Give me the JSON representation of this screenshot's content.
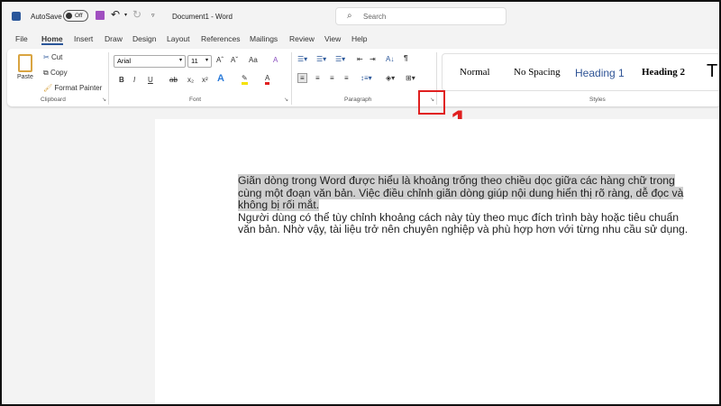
{
  "titlebar": {
    "autosave_label": "AutoSave",
    "autosave_state": "Off",
    "doc_title": "Document1 - Word",
    "search_placeholder": "Search"
  },
  "tabs": [
    "File",
    "Home",
    "Insert",
    "Draw",
    "Design",
    "Layout",
    "References",
    "Mailings",
    "Review",
    "View",
    "Help"
  ],
  "clipboard": {
    "paste": "Paste",
    "cut": "Cut",
    "copy": "Copy",
    "format_painter": "Format Painter",
    "label": "Clipboard"
  },
  "font": {
    "name": "Arial",
    "size": "11",
    "grow": "Aˆ",
    "shrink": "Aˇ",
    "case": "Aa",
    "bold": "B",
    "italic": "I",
    "underline": "U",
    "strike": "ab",
    "sub": "x₂",
    "sup": "x²",
    "effects": "A",
    "highlight": "✎",
    "color": "A",
    "label": "Font"
  },
  "paragraph": {
    "label": "Paragraph",
    "pilcrow": "¶",
    "sort": "A↓"
  },
  "styles": {
    "items": [
      "Normal",
      "No Spacing",
      "Heading 1",
      "Heading 2",
      "T"
    ],
    "label": "Styles"
  },
  "annotation": {
    "number": "1"
  },
  "document": {
    "highlighted": "Giãn dòng trong Word được hiểu là khoảng trống theo chiều dọc giữa các hàng chữ trong cùng một đoạn văn bản. Việc điều chỉnh giãn dòng giúp nội dung hiển thị rõ ràng, dễ đọc và không bị rối mắt.",
    "paragraph2": "Người dùng có thể tùy chỉnh khoảng cách này tùy theo mục đích trình bày hoặc tiêu chuẩn văn bản. Nhờ vậy, tài liệu trở nên chuyên nghiệp và phù hợp hơn với từng nhu cầu sử dụng."
  },
  "colors": {
    "accent": "#2b579a",
    "annotation": "#e02020",
    "heading1": "#2f5496"
  }
}
